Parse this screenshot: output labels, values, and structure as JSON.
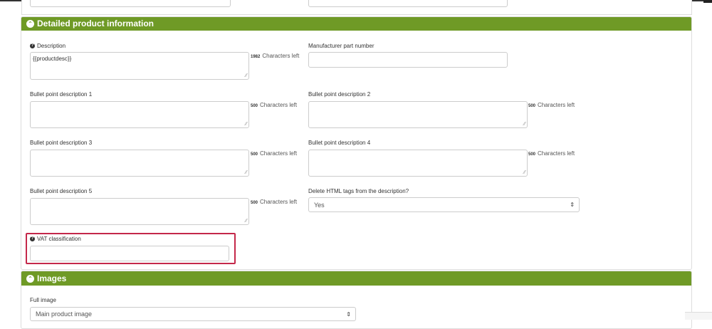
{
  "sections": {
    "detailed": {
      "title": "Detailed product information",
      "description": {
        "label": "Description",
        "value": "{{productdesc}}",
        "chars_left": "1982",
        "chars_left_suffix": "Characters left"
      },
      "manufacturer_part": {
        "label": "Manufacturer part number",
        "value": ""
      },
      "bullet1": {
        "label": "Bullet point description 1",
        "chars_left": "500",
        "chars_left_suffix": "Characters left"
      },
      "bullet2": {
        "label": "Bullet point description 2",
        "chars_left": "500",
        "chars_left_suffix": "Characters left"
      },
      "bullet3": {
        "label": "Bullet point description 3",
        "chars_left": "500",
        "chars_left_suffix": "Characters left"
      },
      "bullet4": {
        "label": "Bullet point description 4",
        "chars_left": "500",
        "chars_left_suffix": "Characters left"
      },
      "bullet5": {
        "label": "Bullet point description 5",
        "chars_left": "500",
        "chars_left_suffix": "Characters left"
      },
      "delete_html": {
        "label": "Delete HTML tags from the description?",
        "value": "Yes"
      },
      "vat": {
        "label": "VAT classification",
        "value": ""
      }
    },
    "images": {
      "title": "Images",
      "full_image": {
        "label": "Full image",
        "value": "Main product image"
      }
    }
  },
  "icons": {
    "collapse": "chevron-up-circle-icon",
    "help": "question-circle-icon",
    "select": "sort-arrows-icon",
    "resize": "resize-grip-icon"
  },
  "colors": {
    "panel_header": "#6f9a26",
    "highlight": "#c4284a"
  }
}
